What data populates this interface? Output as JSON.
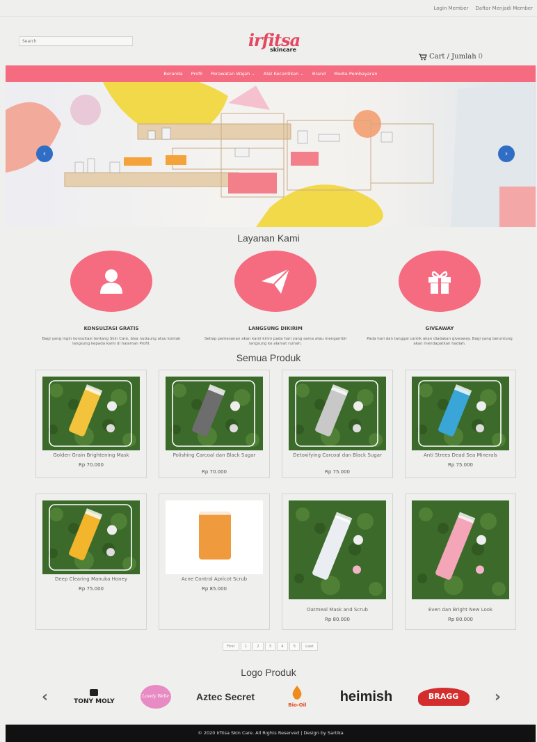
{
  "topbar": {
    "login": "Login Member",
    "register": "Daftar Menjadi Member"
  },
  "header": {
    "search_placeholder": "Search",
    "logo_text": "irfitsa",
    "logo_sub": "skincare",
    "cart_label": "Cart / Jumlah",
    "cart_count": "0"
  },
  "nav": {
    "items": [
      "Beranda",
      "Profil",
      "Perawatan Wajah ⌄",
      "Alat Kecantikan ⌄",
      "Brand",
      "Media Pembayaran"
    ]
  },
  "hero": {
    "prev": "‹",
    "next": "›"
  },
  "services": {
    "heading": "Layanan Kami",
    "items": [
      {
        "title": "KONSULTASI GRATIS",
        "desc": "Bagi yang ingin konsultasi tentang Skin Care, bisa nuduung atau kontak langsung kepada kami di halaman Profil."
      },
      {
        "title": "LANGSUNG DIKIRIM",
        "desc": "Setiap pemesanan akan kami kirim pada hari yang sama atau mengambil langsung ke alamat rumah."
      },
      {
        "title": "GIVEAWAY",
        "desc": "Pada hari dan tanggal cantik akan diadakan giveaway. Bagi yang beruntung akan mendapatkan hadiah."
      }
    ]
  },
  "products": {
    "heading": "Semua Produk",
    "items": [
      {
        "name": "Golden Grain Brightening Mask",
        "price": "Rp 70.000",
        "tube": "#f3c43b"
      },
      {
        "name": "Polishing Carcoal dan Black Sugar",
        "price": "Rp 70.000",
        "tube": "#6d6d6d"
      },
      {
        "name": "Detoxifying Carcoal dan Black Sugar",
        "price": "Rp 75.000",
        "tube": "#c8c8c8"
      },
      {
        "name": "Anti Strees Dead Sea Minerals",
        "price": "Rp 75.000",
        "tube": "#3aa6d8"
      },
      {
        "name": "Deep Clearing Manuka Honey",
        "price": "Rp 75.000",
        "tube": "#f2b52b"
      },
      {
        "name": "Acne Control Apricot Scrub",
        "price": "Rp 85.000",
        "tube": "#f09a3e"
      },
      {
        "name": "Oatmeal Mask and Scrub",
        "price": "Rp 80.000",
        "tube": "#eaeef2"
      },
      {
        "name": "Even dan Bright New Look",
        "price": "Rp 80.000",
        "tube": "#f4a5b8"
      }
    ]
  },
  "pagination": [
    "First",
    "1",
    "2",
    "3",
    "4",
    "5",
    "Last"
  ],
  "brands": {
    "heading": "Logo Produk",
    "prev": "‹",
    "next": "›",
    "items": [
      "TONY MOLY",
      "Lovely Welle",
      "Aztec Secret",
      "Bio-Oil",
      "heimish",
      "BRAGG"
    ]
  },
  "footer": {
    "text": "© 2020 Irfitsa Skin Care. All Rights Reserved | Design by Sartika"
  },
  "colors": {
    "accent": "#f56b80",
    "logo": "#e4475f",
    "footer": "#111111",
    "arrow": "#2f6ec4"
  }
}
